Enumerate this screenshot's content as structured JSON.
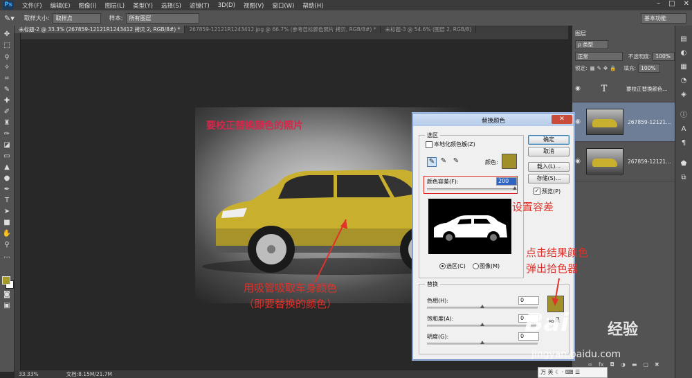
{
  "app": {
    "logo": "Ps"
  },
  "menu": [
    "文件(F)",
    "编辑(E)",
    "图像(I)",
    "图层(L)",
    "类型(Y)",
    "选择(S)",
    "滤镜(T)",
    "3D(D)",
    "视图(V)",
    "窗口(W)",
    "帮助(H)"
  ],
  "window_controls": [
    "–",
    "□",
    "✕"
  ],
  "options_bar": {
    "sample_size_label": "取样大小:",
    "sample_size_value": "取样点",
    "sample_label": "样本:",
    "sample_value": "所有图层",
    "workspace": "基本功能"
  },
  "doc_tabs": [
    {
      "label": "未标题-2 @ 33.3% (267859-12121R1243412 拷贝 2, RGB/8#) *",
      "active": true
    },
    {
      "label": "267859-12121R1243412.jpg @ 66.7% (参考目标颜色照片 拷贝, RGB/8#) *",
      "active": false
    },
    {
      "label": "未标题-3 @ 54.6% (图层 2, RGB/8)",
      "active": false
    }
  ],
  "canvas": {
    "photo_title": "要校正替换颜色的照片"
  },
  "status": {
    "zoom": "33.33%",
    "doc": "文档:8.15M/21.7M"
  },
  "layers_panel": {
    "tab": "图层",
    "filter": "ρ 类型",
    "blend_mode": "正常",
    "opacity_label": "不透明度:",
    "opacity_value": "100%",
    "lock_label": "锁定:",
    "fill_label": "填充:",
    "fill_value": "100%",
    "layers": [
      {
        "name": "要校正替换颜色...",
        "type": "text",
        "glyph": "T",
        "selected": false
      },
      {
        "name": "267859-12121...",
        "type": "image",
        "selected": true
      },
      {
        "name": "267859-12121...",
        "type": "image",
        "selected": false
      }
    ],
    "footer_icons": [
      "link-icon",
      "fx-icon",
      "mask-icon",
      "adjustment-icon",
      "folder-icon",
      "new-layer-icon",
      "trash-icon"
    ]
  },
  "dialog": {
    "title": "替换颜色",
    "close": "✕",
    "selection_group": "选区",
    "localized_clusters_label": "本地化颜色簇(Z)",
    "color_label": "颜色:",
    "fuzziness_label": "颜色容差(F):",
    "fuzziness_value": "200",
    "radio_selection": "选区(C)",
    "radio_image": "图像(M)",
    "buttons": {
      "ok": "确定",
      "cancel": "取消",
      "load": "载入(L)...",
      "save": "存储(S)..."
    },
    "preview_label": "预览(P)",
    "preview_checked": "✓",
    "replacement_group": "替换",
    "hue_label": "色相(H):",
    "hue_value": "0",
    "saturation_label": "饱和度(A):",
    "saturation_value": "0",
    "lightness_label": "明度(G):",
    "lightness_value": "0",
    "result_label": "结果",
    "selected_color": "#a1902a"
  },
  "annotations": {
    "set_tolerance": "设置容差",
    "click_result_1": "点击结果颜色",
    "click_result_2": "弹出拾色器",
    "eyedropper_1": "用吸管吸取车身颜色",
    "eyedropper_2": "（即要替换的颜色）"
  },
  "watermark": {
    "brand": "Bai",
    "brand_cn": "经验",
    "url": "jingyan.baidu.com"
  },
  "ime": {
    "label": "英"
  },
  "colors": {
    "foreground": "#a69a2b",
    "background": "#ffffff",
    "annotation": "#e0312a",
    "photo_title": "#d6274a"
  }
}
